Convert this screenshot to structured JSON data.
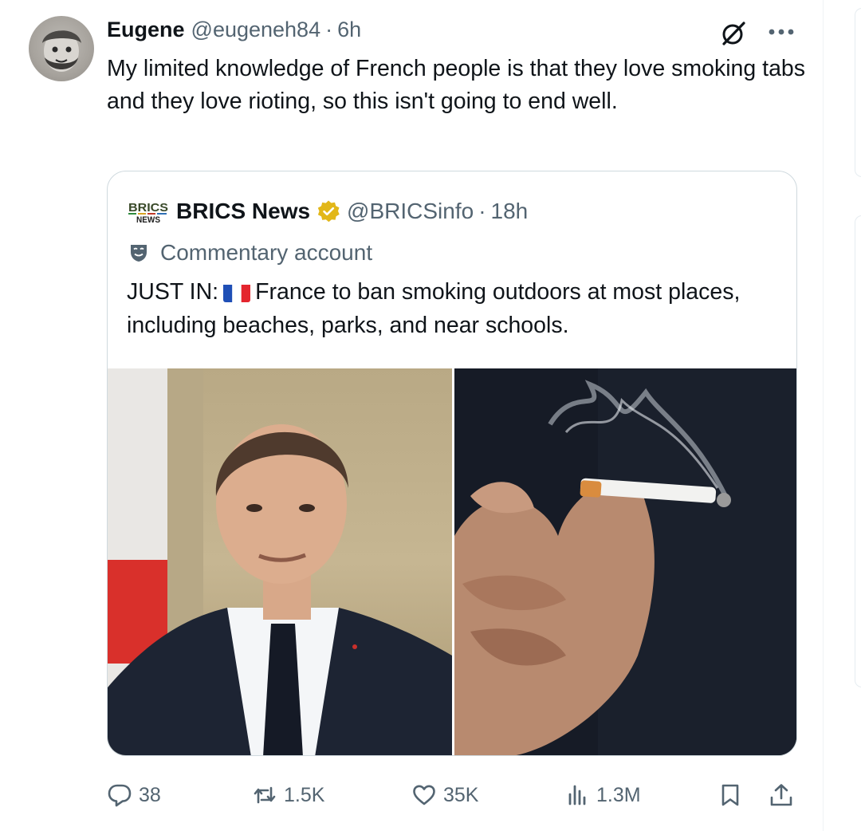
{
  "tweet": {
    "author_name": "Eugene",
    "author_handle": "@eugeneh84",
    "separator": "·",
    "age": "6h",
    "text": "My limited knowledge of French people is that they love smoking tabs and they love rioting, so this isn't going to end well."
  },
  "quoted": {
    "logo_text_top": "BRICS",
    "logo_text_bottom": "NEWS",
    "name": "BRICS News",
    "handle": "@BRICSinfo",
    "separator": "·",
    "age": "18h",
    "label": "Commentary account",
    "text_prefix": "JUST IN:",
    "text_body": "France to ban smoking outdoors at most places, including beaches, parks, and near schools.",
    "images": [
      "portrait-photo",
      "cigarette-photo"
    ]
  },
  "actions": {
    "replies": "38",
    "reposts": "1.5K",
    "likes": "35K",
    "views": "1.3M"
  },
  "colors": {
    "text": "#0f1419",
    "secondary": "#536471",
    "border": "#cfd9de",
    "verified_gold": "#e2b719",
    "flag_blue": "#1f4fb6",
    "flag_red": "#e4252e"
  },
  "icons": [
    "grok-icon",
    "more-icon",
    "verified-icon",
    "mask-icon",
    "reply-icon",
    "repost-icon",
    "like-icon",
    "views-icon",
    "bookmark-icon",
    "share-icon"
  ]
}
